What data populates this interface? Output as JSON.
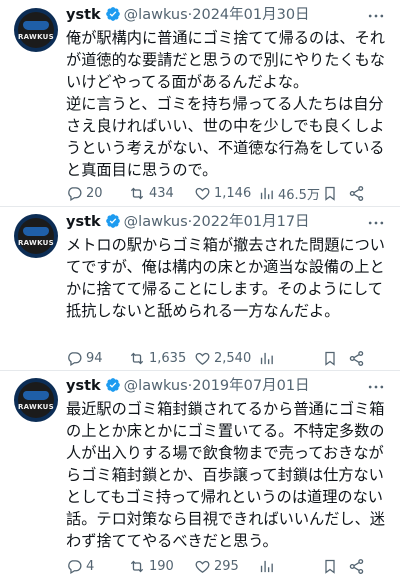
{
  "tweets": [
    {
      "name": "ystk",
      "handle": "@lawkus",
      "date": "2024年01月30日",
      "avatar_text": "RAWKUS",
      "text": "俺が駅構内に普通にゴミ捨てて帰るのは、それが道徳的な要請だと思うので別にやりたくもないけどやってる面があるんだよな。\n逆に言うと、ゴミを持ち帰ってる人たちは自分さえ良ければいい、世の中を少しでも良くしようという考えがない、不道徳な行為をしていると真面目に思うので。",
      "replies": "20",
      "retweets": "434",
      "likes": "1,146",
      "views": "46.5万"
    },
    {
      "name": "ystk",
      "handle": "@lawkus",
      "date": "2022年01月17日",
      "avatar_text": "RAWKUS",
      "text": "メトロの駅からゴミ箱が撤去された問題についてですが、俺は構内の床とか適当な設備の上とかに捨てて帰ることにします。そのようにして抵抗しないと舐められる一方なんだよ。",
      "replies": "94",
      "retweets": "1,635",
      "likes": "2,540",
      "views": ""
    },
    {
      "name": "ystk",
      "handle": "@lawkus",
      "date": "2019年07月01日",
      "avatar_text": "RAWKUS",
      "text": "最近駅のゴミ箱封鎖されてるから普通にゴミ箱の上とか床とかにゴミ置いてる。不特定多数の人が出入りする場で飲食物まで売っておきながらゴミ箱封鎖とか、百歩譲って封鎖は仕方ないとしてもゴミ持って帰れというのは道理のない話。テロ対策なら目視できればいいんだし、迷わず捨ててやるべきだと思う。",
      "replies": "4",
      "retweets": "190",
      "likes": "295",
      "views": ""
    }
  ],
  "separator": "·",
  "icons": {
    "verified": "verified-badge-icon",
    "more": "more-options-icon",
    "reply": "reply-icon",
    "retweet": "retweet-icon",
    "like": "heart-icon",
    "views": "views-chart-icon",
    "bookmark": "bookmark-icon",
    "share": "share-icon"
  },
  "colors": {
    "text": "#0f1419",
    "secondary": "#536471",
    "verified": "#1d9bf0",
    "avatar_bg": "#0c2d55"
  }
}
